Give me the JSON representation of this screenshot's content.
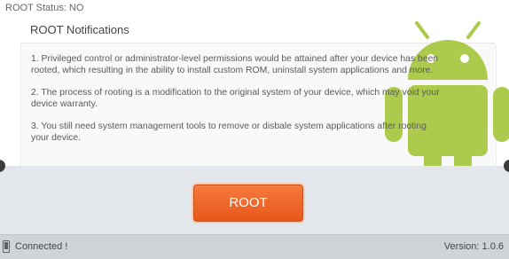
{
  "status": {
    "root_status": "ROOT Status: NO"
  },
  "notifications": {
    "title": "ROOT Notifications",
    "items": [
      {
        "line1": "1. Privileged control or administrator-level permissions would be attained after your device has been",
        "line2": "rooted, which resulting in the ability to install custom ROM, uninstall system applications and more."
      },
      {
        "line1": "2. The process of rooting is a modification to the original system of your device, which may void your",
        "line2": "device warranty."
      },
      {
        "line1": "3. You still need system management tools to remove or disbale system applications after rooting",
        "line2": "your device."
      }
    ]
  },
  "action": {
    "root_label": "ROOT"
  },
  "footer": {
    "connection": "Connected !",
    "version": "Version: 1.0.6"
  },
  "colors": {
    "accent": "#e8571c",
    "android_green": "#a4c639"
  },
  "icons": {
    "robot": "android-robot-icon",
    "device": "phone-icon"
  }
}
